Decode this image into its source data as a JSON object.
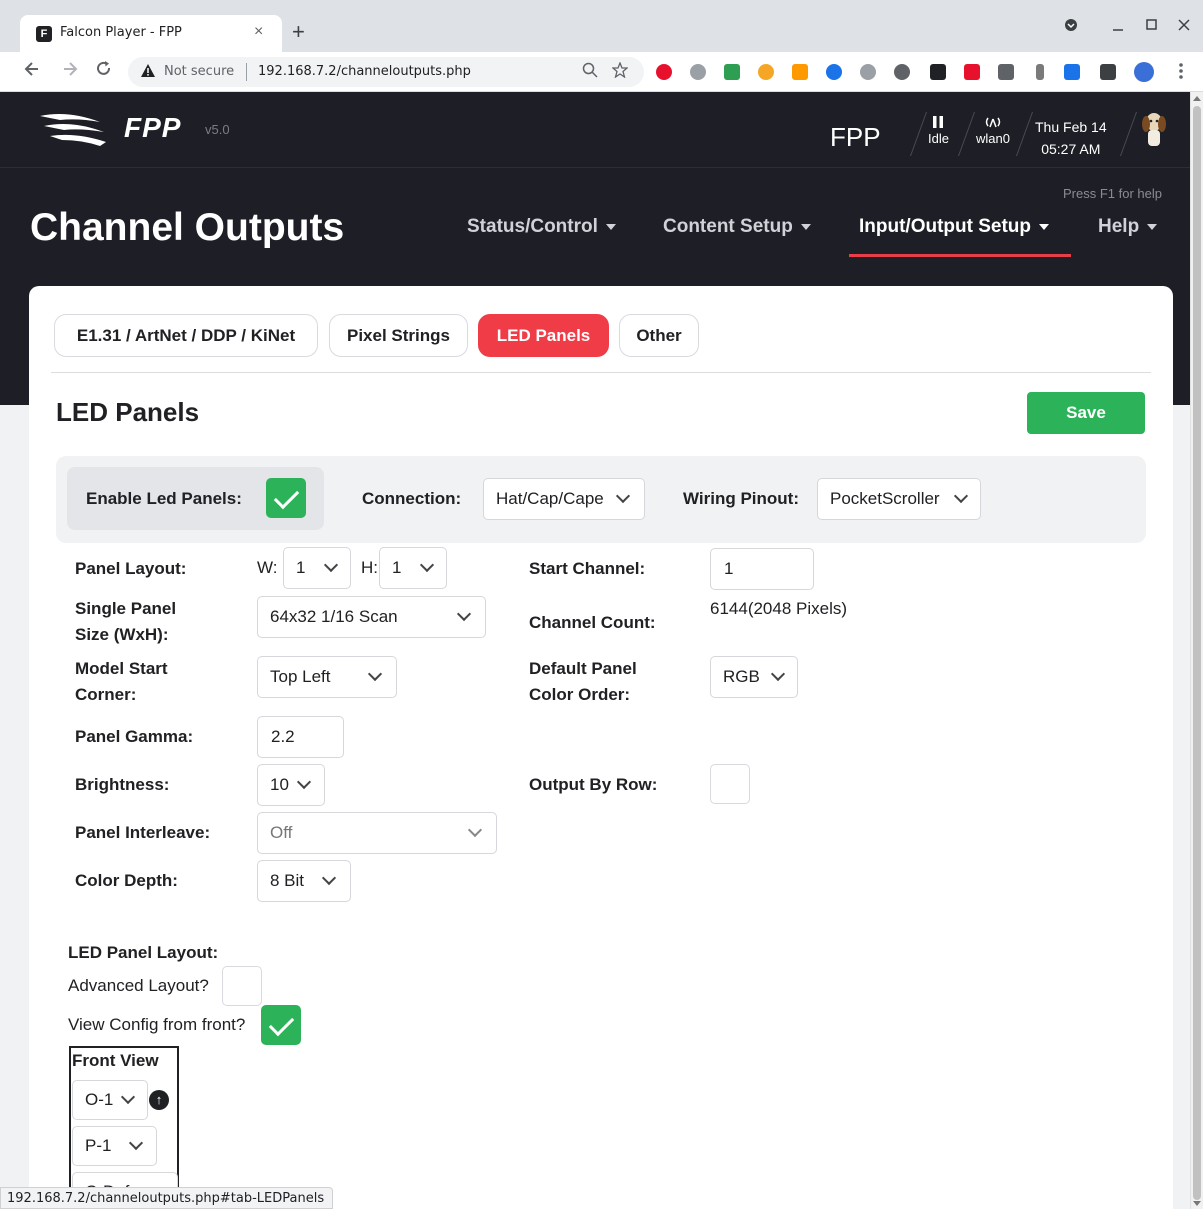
{
  "browser": {
    "tab_title": "Falcon Player - FPP",
    "tab_close": "×",
    "new_tab": "+",
    "address_security": "Not secure",
    "address_url": "192.168.7.2/channeloutputs.php",
    "status_url": "192.168.7.2/channeloutputs.php#tab-LEDPanels"
  },
  "header": {
    "logo": "FPP",
    "version": "v5.0",
    "host": "FPP",
    "status_label": "Idle",
    "network_label": "wlan0",
    "date": "Thu Feb 14",
    "time": "05:27 AM",
    "help_hint": "Press F1 for help"
  },
  "page_title": "Channel Outputs",
  "main_nav": [
    {
      "label": "Status/Control"
    },
    {
      "label": "Content Setup"
    },
    {
      "label": "Input/Output Setup",
      "active": true
    },
    {
      "label": "Help"
    }
  ],
  "subtabs": [
    {
      "label": "E1.31 / ArtNet / DDP / KiNet"
    },
    {
      "label": "Pixel Strings"
    },
    {
      "label": "LED Panels",
      "active": true
    },
    {
      "label": "Other"
    }
  ],
  "section": {
    "title": "LED Panels",
    "save_label": "Save"
  },
  "config_bar": {
    "enable_label": "Enable Led Panels:",
    "enable_checked": true,
    "connection_label": "Connection:",
    "connection_value": "Hat/Cap/Cape",
    "wiring_label": "Wiring Pinout:",
    "wiring_value": "PocketScroller"
  },
  "settings": {
    "panel_layout_label": "Panel Layout:",
    "w_label": "W:",
    "w_value": "1",
    "h_label": "H:",
    "h_value": "1",
    "start_channel_label": "Start Channel:",
    "start_channel_value": "1",
    "single_panel_label_1": "Single Panel",
    "single_panel_label_2": "Size (WxH):",
    "single_panel_value": "64x32 1/16 Scan",
    "channel_count_label": "Channel Count:",
    "channel_count_value": "6144(2048 Pixels)",
    "model_start_label_1": "Model Start",
    "model_start_label_2": "Corner:",
    "model_start_value": "Top Left",
    "default_order_label_1": "Default Panel",
    "default_order_label_2": "Color Order:",
    "default_order_value": "RGB",
    "gamma_label": "Panel Gamma:",
    "gamma_value": "2.2",
    "brightness_label": "Brightness:",
    "brightness_value": "10",
    "output_by_row_label": "Output By Row:",
    "output_by_row_checked": false,
    "interleave_label": "Panel Interleave:",
    "interleave_value": "Off",
    "color_depth_label": "Color Depth:",
    "color_depth_value": "8 Bit"
  },
  "layout": {
    "title": "LED Panel Layout:",
    "advanced_label": "Advanced Layout?",
    "advanced_checked": false,
    "view_front_label": "View Config from front?",
    "view_front_checked": true,
    "front_view_header": "Front View",
    "output_value": "O-1",
    "panel_value": "P-1",
    "color_value": "C-Def"
  },
  "colors": {
    "accent": "#f03c47",
    "save": "#2cb359",
    "header_bg": "#1e1f26"
  }
}
